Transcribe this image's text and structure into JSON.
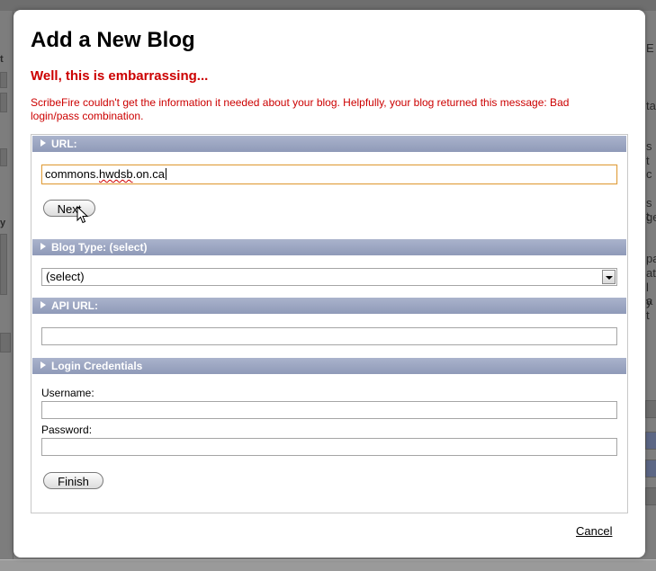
{
  "dialog": {
    "title": "Add a New Blog",
    "error_title": "Well, this is embarrassing...",
    "error_message": "ScribeFire couldn't get the information it needed about your blog. Helpfully, your blog returned this message: Bad login/pass combination.",
    "cancel_label": "Cancel"
  },
  "sections": {
    "url": {
      "header": "URL:",
      "value": "commons.hwdsb.on.ca",
      "next_label": "Next"
    },
    "blog_type": {
      "header": "Blog Type: (select)",
      "selected": "(select)"
    },
    "api_url": {
      "header": "API URL:",
      "value": ""
    },
    "login": {
      "header": "Login Credentials",
      "username_label": "Username:",
      "username_value": "",
      "password_label": "Password:",
      "password_value": "",
      "finish_label": "Finish"
    }
  },
  "background": {
    "fragments": [
      "t",
      "E",
      "ta",
      "s",
      "t c",
      "s t",
      "ge",
      "y",
      "pa",
      "at",
      "l a",
      "y t"
    ]
  },
  "colors": {
    "error": "#cc0000",
    "section_header": "#9aa4c0",
    "focus_border": "#e0a040"
  }
}
